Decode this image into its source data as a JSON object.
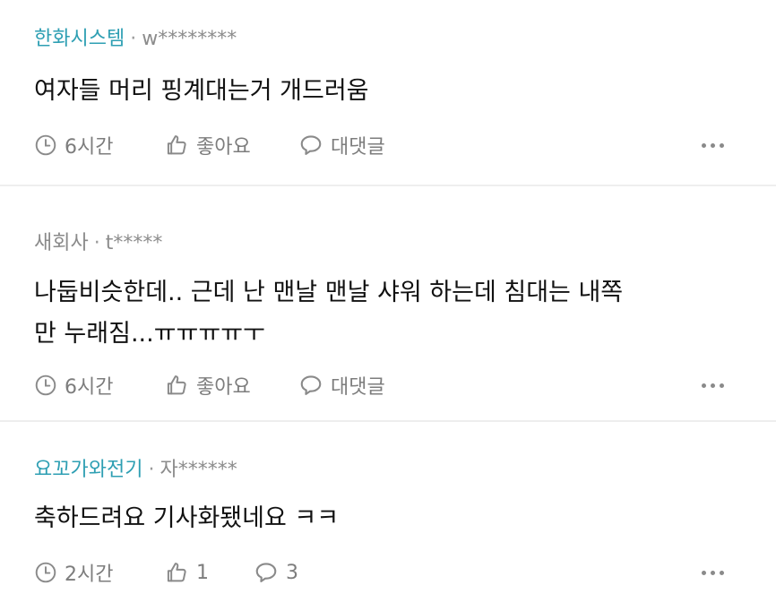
{
  "comments": [
    {
      "author": "한화시스템",
      "separator": "·",
      "user_id": "w********",
      "text": "여자들 머리 핑계대는거 개드러움",
      "time": "6시간",
      "like_label": "좋아요",
      "reply_label": "대댓글"
    },
    {
      "author": "새회사",
      "separator": "·",
      "user_id": "t*****",
      "text_line1": "나둡비슷한데.. 근데 난 맨날 맨날 샤워 하는데 침대는 내쪽",
      "text_line2": "만 누래짐...ㅠㅠㅠㅠㅜ",
      "time": "6시간",
      "like_label": "좋아요",
      "reply_label": "대댓글"
    },
    {
      "author": "요꼬가와전기",
      "separator": "·",
      "user_id": "자******",
      "text": "축하드려요 기사화됐네요 ㅋㅋ",
      "time": "2시간",
      "like_count": "1",
      "reply_count": "3"
    }
  ],
  "icons": {
    "time": "clock-icon",
    "like": "thumbs-up-icon",
    "reply": "speech-bubble-icon",
    "more": "more-options-icon"
  },
  "colors": {
    "author_accent": "#2e9fb3",
    "meta_gray": "#8c8c8c",
    "text": "#111111"
  }
}
